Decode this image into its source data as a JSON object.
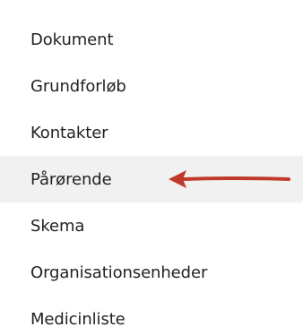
{
  "menu": {
    "items": [
      {
        "label": "Dokument"
      },
      {
        "label": "Grundforløb"
      },
      {
        "label": "Kontakter"
      },
      {
        "label": "Pårørende"
      },
      {
        "label": "Skema"
      },
      {
        "label": "Organisationsenheder"
      },
      {
        "label": "Medicinliste"
      }
    ]
  },
  "colors": {
    "active_background": "#f1f1f1",
    "annotation_arrow": "#c0392b"
  },
  "annotation": {
    "icon": "red-arrow-left-icon"
  }
}
